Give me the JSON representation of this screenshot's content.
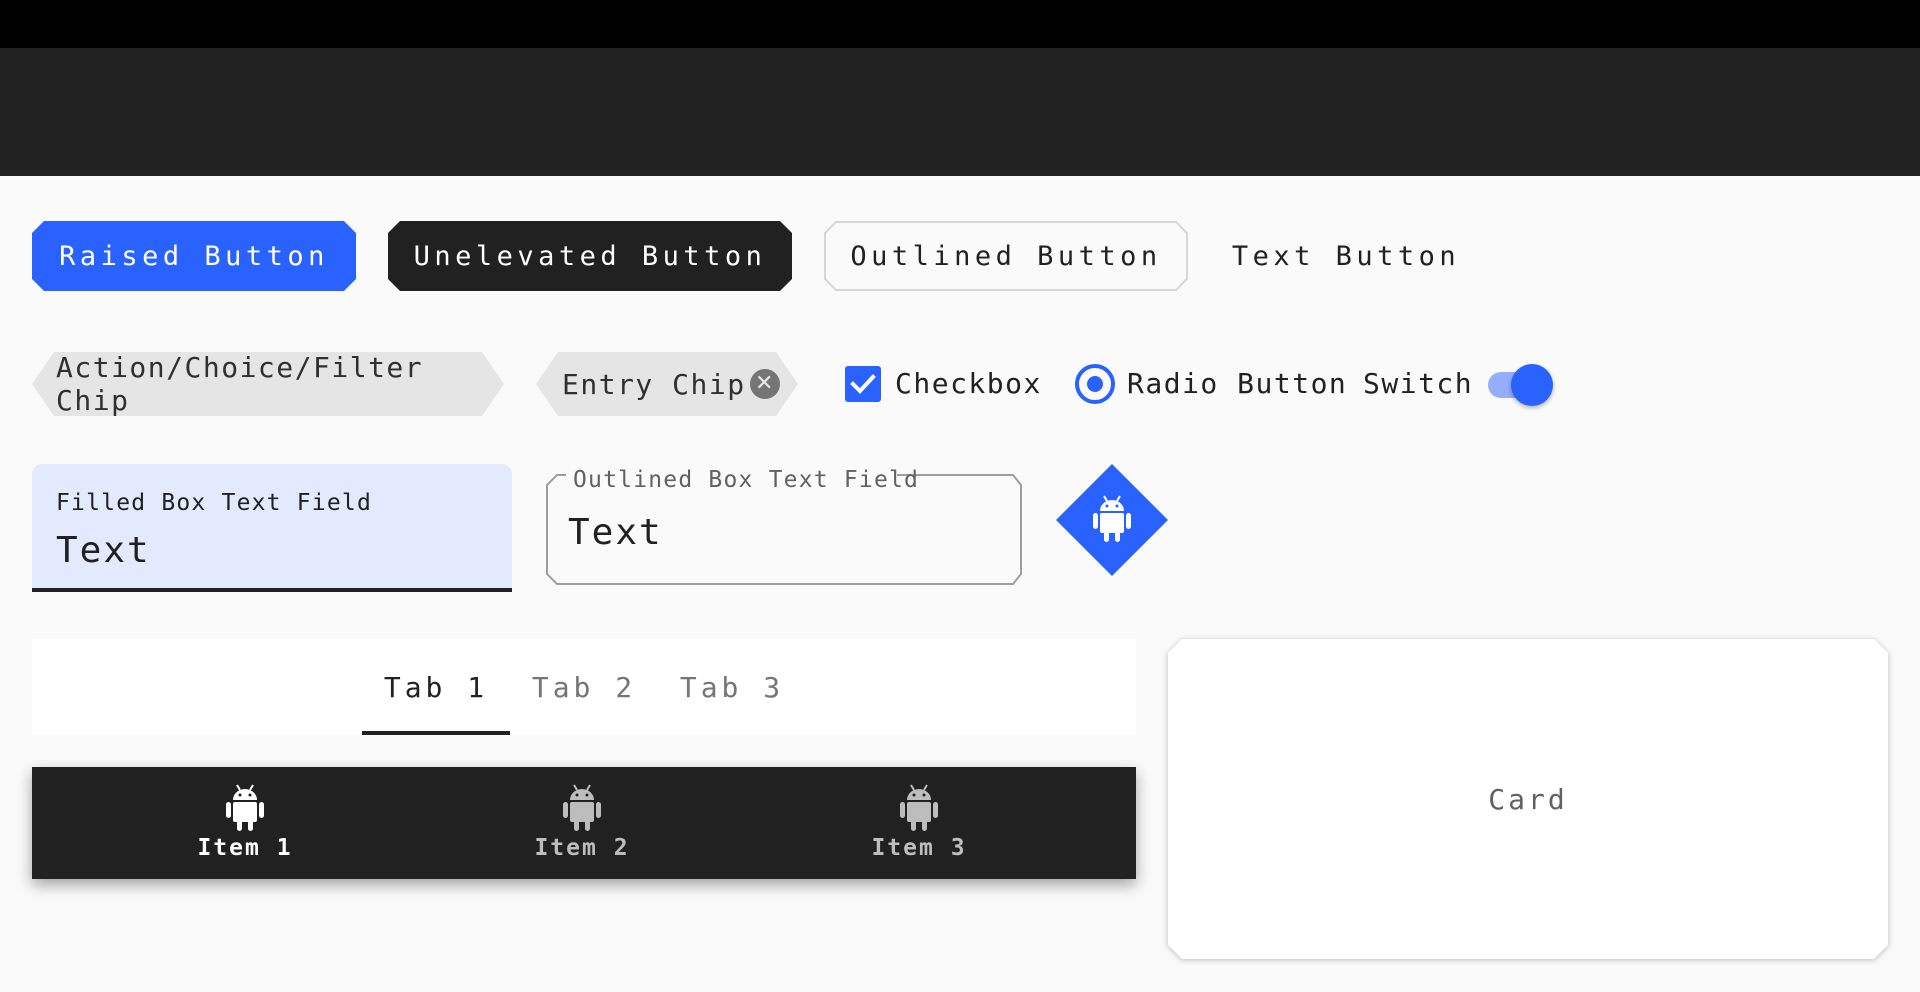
{
  "colors": {
    "primary": "#2962ff",
    "surface_dark": "#212121",
    "status_bar": "#000000",
    "background": "#fafafa",
    "chip": "#e5e5e5",
    "filled_field": "#e3eafd"
  },
  "buttons": {
    "raised": "Raised Button",
    "unelevated": "Unelevated Button",
    "outlined": "Outlined Button",
    "text": "Text Button"
  },
  "chips": {
    "action": "Action/Choice/Filter Chip",
    "entry": "Entry Chip",
    "entry_close_icon": "close-icon"
  },
  "controls": {
    "checkbox_label": "Checkbox",
    "checkbox_checked": true,
    "radio_label": "Radio Button",
    "radio_selected": true,
    "switch_label": "Switch",
    "switch_on": true
  },
  "text_fields": {
    "filled": {
      "label": "Filled Box Text Field",
      "value": "Text"
    },
    "outlined": {
      "label": "Outlined Box Text Field",
      "value": "Text"
    }
  },
  "fab": {
    "icon": "android-icon"
  },
  "tabs": [
    {
      "label": "Tab 1",
      "active": true
    },
    {
      "label": "Tab 2",
      "active": false
    },
    {
      "label": "Tab 3",
      "active": false
    }
  ],
  "bottom_nav": [
    {
      "label": "Item 1",
      "icon": "android-icon",
      "active": true
    },
    {
      "label": "Item 2",
      "icon": "android-icon",
      "active": false
    },
    {
      "label": "Item 3",
      "icon": "android-icon",
      "active": false
    }
  ],
  "card": {
    "label": "Card"
  }
}
